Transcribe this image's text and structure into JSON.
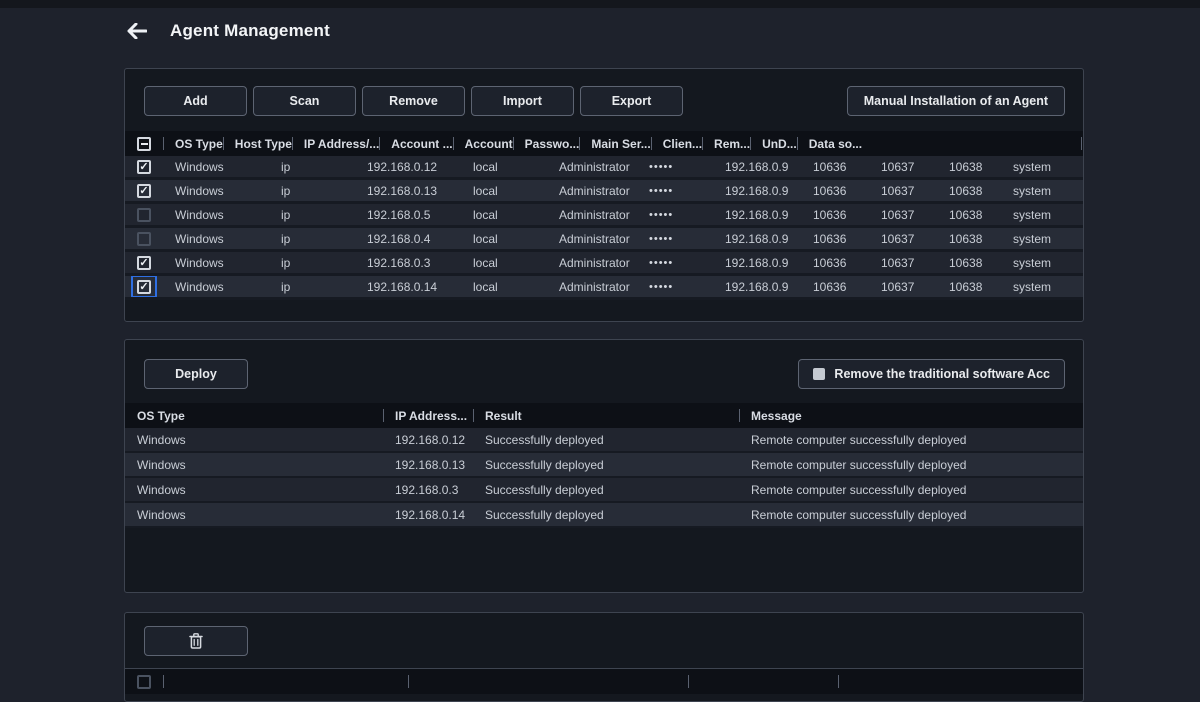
{
  "header": {
    "title": "Agent Management"
  },
  "agents_panel": {
    "toolbar_buttons": [
      {
        "label": "Add"
      },
      {
        "label": "Scan"
      },
      {
        "label": "Remove"
      },
      {
        "label": "Import"
      },
      {
        "label": "Export"
      }
    ],
    "manual_install_button": "Manual Installation of an Agent",
    "table": {
      "select_all_state": "indeterminate",
      "columns": [
        {
          "label": "OS Type"
        },
        {
          "label": "Host Type"
        },
        {
          "label": "IP Address/..."
        },
        {
          "label": "Account ..."
        },
        {
          "label": "Account"
        },
        {
          "label": "Passwo..."
        },
        {
          "label": "Main Ser..."
        },
        {
          "label": "Clien..."
        },
        {
          "label": "Rem..."
        },
        {
          "label": "UnD..."
        },
        {
          "label": "Data so..."
        }
      ],
      "rows": [
        {
          "checked": true,
          "focused": false,
          "os_type": "Windows",
          "host_type": "ip",
          "ip_address": "192.168.0.12",
          "account_type": "local",
          "account": "Administrator",
          "password": "•••••",
          "main_server": "192.168.0.9",
          "client": "10636",
          "rem": "10637",
          "und": "10638",
          "data_source": "system"
        },
        {
          "checked": true,
          "focused": false,
          "os_type": "Windows",
          "host_type": "ip",
          "ip_address": "192.168.0.13",
          "account_type": "local",
          "account": "Administrator",
          "password": "•••••",
          "main_server": "192.168.0.9",
          "client": "10636",
          "rem": "10637",
          "und": "10638",
          "data_source": "system"
        },
        {
          "checked": false,
          "focused": false,
          "os_type": "Windows",
          "host_type": "ip",
          "ip_address": "192.168.0.5",
          "account_type": "local",
          "account": "Administrator",
          "password": "•••••",
          "main_server": "192.168.0.9",
          "client": "10636",
          "rem": "10637",
          "und": "10638",
          "data_source": "system"
        },
        {
          "checked": false,
          "focused": false,
          "os_type": "Windows",
          "host_type": "ip",
          "ip_address": "192.168.0.4",
          "account_type": "local",
          "account": "Administrator",
          "password": "•••••",
          "main_server": "192.168.0.9",
          "client": "10636",
          "rem": "10637",
          "und": "10638",
          "data_source": "system"
        },
        {
          "checked": true,
          "focused": false,
          "os_type": "Windows",
          "host_type": "ip",
          "ip_address": "192.168.0.3",
          "account_type": "local",
          "account": "Administrator",
          "password": "•••••",
          "main_server": "192.168.0.9",
          "client": "10636",
          "rem": "10637",
          "und": "10638",
          "data_source": "system"
        },
        {
          "checked": true,
          "focused": true,
          "os_type": "Windows",
          "host_type": "ip",
          "ip_address": "192.168.0.14",
          "account_type": "local",
          "account": "Administrator",
          "password": "•••••",
          "main_server": "192.168.0.9",
          "client": "10636",
          "rem": "10637",
          "und": "10638",
          "data_source": "system"
        }
      ]
    }
  },
  "deploy_panel": {
    "deploy_button": "Deploy",
    "remove_traditional_label": "Remove the traditional software Acc",
    "table": {
      "columns": [
        {
          "label": "OS Type"
        },
        {
          "label": "IP Address..."
        },
        {
          "label": "Result"
        },
        {
          "label": "Message"
        }
      ],
      "rows": [
        {
          "os_type": "Windows",
          "ip_address": "192.168.0.12",
          "result": "Successfully deployed",
          "message": "Remote computer successfully deployed"
        },
        {
          "os_type": "Windows",
          "ip_address": "192.168.0.13",
          "result": "Successfully deployed",
          "message": "Remote computer successfully deployed"
        },
        {
          "os_type": "Windows",
          "ip_address": "192.168.0.3",
          "result": "Successfully deployed",
          "message": "Remote computer successfully deployed"
        },
        {
          "os_type": "Windows",
          "ip_address": "192.168.0.14",
          "result": "Successfully deployed",
          "message": "Remote computer successfully deployed"
        }
      ]
    }
  },
  "uninstall_panel": {
    "delete_icon": "trash-icon"
  }
}
